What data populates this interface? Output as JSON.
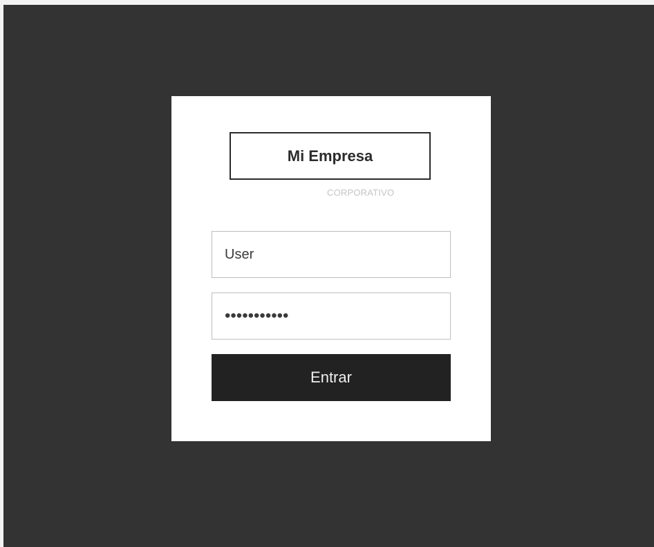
{
  "logo": {
    "name": "Mi Empresa",
    "subtitle": "CORPORATIVO"
  },
  "form": {
    "username_value": "User",
    "password_value": "•••••••••••",
    "submit_label": "Entrar"
  },
  "colors": {
    "background": "#333333",
    "card": "#ffffff",
    "button": "#222222",
    "button_text": "#f0f0f0",
    "subtitle": "#c4c4c4"
  }
}
